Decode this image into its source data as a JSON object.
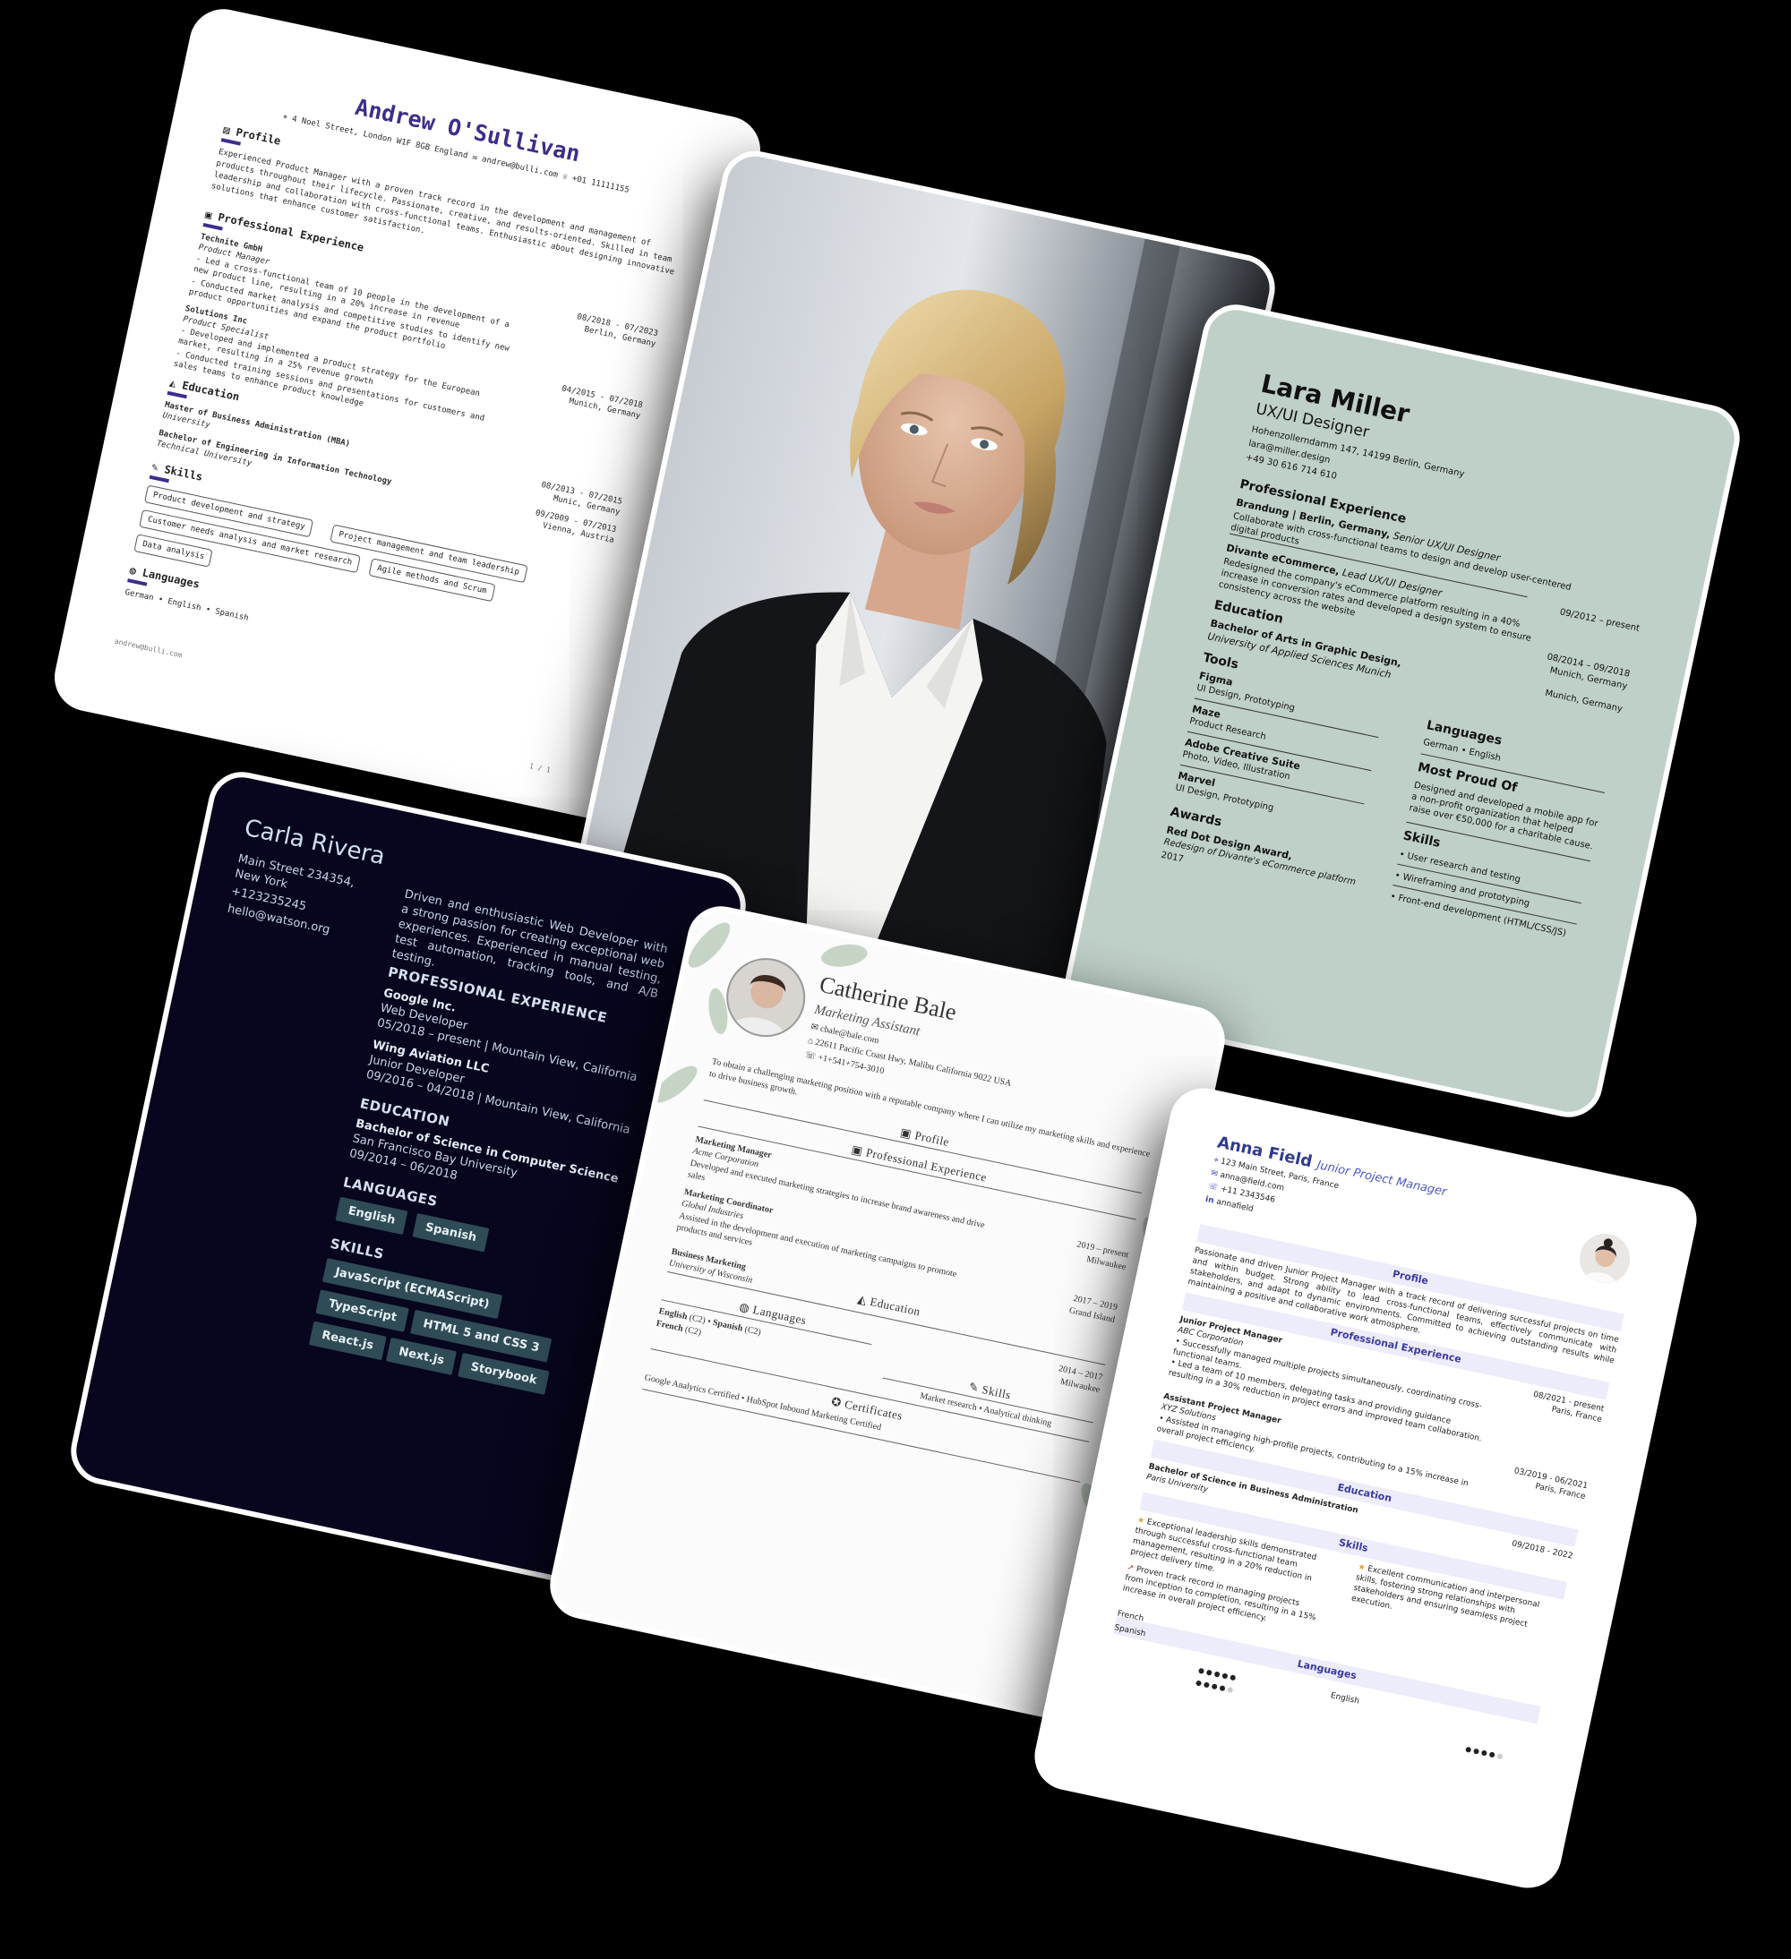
{
  "andrew": {
    "name": "Andrew O'Sullivan",
    "address": "4 Noel Street, London W1F 8GB England",
    "email": "andrew@bulli.com",
    "phone": "+01 11111155",
    "profile_title": "Profile",
    "profile_text": "Experienced Product Manager with a proven track record in the development and management of products throughout their lifecycle. Passionate, creative, and results-oriented. Skilled in team leadership and collaboration with cross-functional teams. Enthusiastic about designing innovative solutions that enhance customer satisfaction.",
    "experience_title": "Professional Experience",
    "jobs": [
      {
        "company": "Technite GmbH",
        "role": "Product Manager",
        "bullets": [
          "- Led a cross-functional team of 10 people in the development of a new product line, resulting in a 20% increase in revenue",
          "- Conducted market analysis and competitive studies to identify new product opportunities and expand the product portfolio"
        ],
        "dates": "08/2018 - 07/2023",
        "location": "Berlin, Germany"
      },
      {
        "company": "Solutions Inc",
        "role": "Product Specialist",
        "bullets": [
          "- Developed and implemented a product strategy for the European market, resulting in a 25% revenue growth",
          "- Conducted training sessions and presentations for customers and sales teams to enhance product knowledge"
        ],
        "dates": "04/2015 - 07/2018",
        "location": "Munich, Germany"
      }
    ],
    "education_title": "Education",
    "education": [
      {
        "degree": "Master of Business Administration (MBA)",
        "school": "University",
        "dates": "08/2013 - 07/2015",
        "location": "Munic, Germany"
      },
      {
        "degree": "Bachelor of Engineering in Information Technology",
        "school": "Technical University",
        "dates": "09/2009 - 07/2013",
        "location": "Vienna, Austria"
      }
    ],
    "skills_title": "Skills",
    "skills": [
      "Product development and strategy",
      "Project management and team leadership",
      "Customer needs analysis and market research",
      "Agile methods and Scrum",
      "Data analysis"
    ],
    "languages_title": "Languages",
    "languages": "German • English • Spanish",
    "footer": "andrew@bulli.com",
    "page": "1 / 1"
  },
  "lara": {
    "name": "Lara Miller",
    "title": "UX/UI Designer",
    "address": "Hohenzollerndamm 147, 14199 Berlin, Germany",
    "email": "lara@miller.design",
    "phone": "+49 30 616 714 610",
    "experience_title": "Professional Experience",
    "jobs": [
      {
        "heading": "Brandung | Berlin, Germany,",
        "role": "Senior UX/UI Designer",
        "text": "Collaborate with cross-functional teams to design and develop user-centered digital products",
        "dates": "09/2012 – present"
      },
      {
        "heading": "Divante eCommerce,",
        "role": "Lead UX/UI Designer",
        "text": "Redesigned the company's eCommerce platform resulting in a 40% increase in conversion rates and developed a design system to ensure consistency across the website",
        "dates": "08/2014 – 09/2018",
        "location": "Munich, Germany"
      }
    ],
    "education_title": "Education",
    "education_degree": "Bachelor of Arts in Graphic Design,",
    "education_school": "University of Applied Sciences Munich",
    "education_location": "Munich, Germany",
    "tools_title": "Tools",
    "tools": [
      {
        "name": "Figma",
        "desc": "UI Design, Prototyping"
      },
      {
        "name": "Maze",
        "desc": "Product Research"
      },
      {
        "name": "Adobe Creative Suite",
        "desc": "Photo, Video, Illustration"
      },
      {
        "name": "Marvel",
        "desc": "UI Design, Prototyping"
      }
    ],
    "languages_title": "Languages",
    "languages": "German • English",
    "proud_title": "Most Proud Of",
    "proud_text": "Designed and developed a mobile app for a non-profit organization that helped raise over €50,000 for a charitable cause.",
    "skills_title": "Skills",
    "skills": [
      "• User research and testing",
      "• Wireframing and prototyping",
      "• Front-end development (HTML/CSS/JS)"
    ],
    "awards_title": "Awards",
    "award_name": "Red Dot Design Award,",
    "award_text": "Redesign of Divante's eCommerce platform",
    "award_year": "2017"
  },
  "carla": {
    "name": "Carla Rivera",
    "address": "Main Street 234354, New York",
    "phone": "+123235245",
    "email": "hello@watson.org",
    "summary": "Driven and enthusiastic Web Developer with a strong passion for creating exceptional web experiences. Experienced in manual testing, test automation, tracking tools, and A/B testing.",
    "experience_title": "PROFESSIONAL EXPERIENCE",
    "jobs": [
      {
        "company": "Google Inc.",
        "role": "Web Developer",
        "dates": "05/2018 – present | Mountain View, California"
      },
      {
        "company": "Wing Aviation LLC",
        "role": "Junior Developer",
        "dates": "09/2016 – 04/2018 | Mountain View, California"
      }
    ],
    "education_title": "EDUCATION",
    "degree": "Bachelor of Science in Computer Science",
    "school": "San Francisco Bay University",
    "edu_dates": "09/2014 – 06/2018",
    "languages_title": "LANGUAGES",
    "languages": [
      "English",
      "Spanish"
    ],
    "skills_title": "SKILLS",
    "skills": [
      "JavaScript (ECMAScript)",
      "TypeScript",
      "HTML 5 and CSS 3",
      "React.js",
      "Next.js",
      "Storybook"
    ]
  },
  "catherine": {
    "name": "Catherine Bale",
    "title": "Marketing Assistant",
    "email": "cbale@bale.com",
    "address": "22611 Pacific Coast Hwy, Malibu California 9022 USA",
    "phone": "+1+541+754-3010",
    "objective": "To obtain a challenging marketing position with a reputable company where I can utilize my marketing skills and experience to drive business growth.",
    "profile_title": "Profile",
    "experience_title": "Professional Experience",
    "jobs": [
      {
        "role": "Marketing Manager",
        "company": "Acme Corporation",
        "text": "Developed and executed marketing strategies to increase brand awareness and drive sales",
        "dates": "2019 – present",
        "location": "Milwaukee"
      },
      {
        "role": "Marketing Coordinator",
        "company": "Global Industries",
        "text": "Assisted in the development and execution of marketing campaigns to promote products and services",
        "dates": "2017 – 2019",
        "location": "Grand Island"
      }
    ],
    "education_title": "Education",
    "degree": "Business Marketing",
    "school": "University of Wisconsin",
    "edu_dates": "2014 – 2017",
    "edu_location": "Milwaukee",
    "languages_title": "Languages",
    "lang1": "English",
    "lang1_level": "(C2)",
    "lang2": "Spanish",
    "lang2_level": "(C2)",
    "lang3": "French",
    "lang3_level": "(C2)",
    "skills_title": "Skills",
    "skills": "Market research • Analytical thinking",
    "certificates_title": "Certificates",
    "certificates": "Google Analytics Certified • HubSpot Inbound Marketing Certified"
  },
  "anna": {
    "name": "Anna Field",
    "title": "Junior Project Manager",
    "address": "123 Main Street, Paris, France",
    "email": "anna@field.com",
    "phone": "+11 2343546",
    "linkedin": "annafield",
    "profile_title": "Profile",
    "profile_text": "Passionate and driven Junior Project Manager with a track record of delivering successful projects on time and within budget. Strong ability to lead cross-functional teams, effectively communicate with stakeholders, and adapt to dynamic environments. Committed to achieving outstanding results while maintaining a positive and collaborative work atmosphere.",
    "experience_title": "Professional Experience",
    "jobs": [
      {
        "role": "Junior Project Manager",
        "company": "ABC Corporation",
        "bullets": [
          "• Successfully managed multiple projects simultaneously, coordinating cross-functional teams.",
          "• Led a team of 10 members, delegating tasks and providing guidance resulting in a 30% reduction in project errors and improved team collaboration."
        ],
        "dates": "08/2021 - present",
        "location": "Paris, France"
      },
      {
        "role": "Assistant Project Manager",
        "company": "XYZ Solutions",
        "bullets": [
          "• Assisted in managing high-profile projects, contributing to a 15% increase in overall project efficiency."
        ],
        "dates": "03/2019 - 06/2021",
        "location": "Paris, France"
      }
    ],
    "education_title": "Education",
    "degree": "Bachelor of Science in Business Administration",
    "school": "Paris University",
    "edu_dates": "09/2018 - 2022",
    "skills_title": "Skills",
    "skill1": "Exceptional leadership skills demonstrated through successful cross-functional team management, resulting in a 20% reduction in project delivery time.",
    "skill2": "Excellent communication and interpersonal skills, fostering strong relationships with stakeholders and ensuring seamless project execution.",
    "skill3": "Proven track record in managing projects from inception to completion, resulting in a 15% increase in overall project efficiency.",
    "languages_title": "Languages",
    "lang1": "French",
    "lang2": "Spanish",
    "lang3": "English",
    "lang_levels": {
      "French": 5,
      "Spanish": 4,
      "English": 4
    }
  }
}
